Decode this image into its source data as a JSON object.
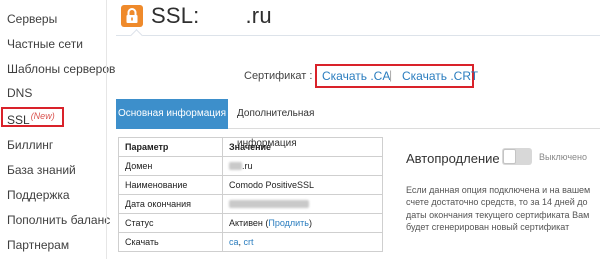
{
  "sidebar": {
    "items": [
      {
        "label": "Серверы"
      },
      {
        "label": "Частные сети"
      },
      {
        "label": "Шаблоны серверов"
      },
      {
        "label": "DNS"
      },
      {
        "label": "SSL",
        "badge": "(New)"
      },
      {
        "label": "Биллинг"
      },
      {
        "label": "База знаний"
      },
      {
        "label": "Поддержка"
      },
      {
        "label": "Пополнить баланс"
      },
      {
        "label": "Партнерам"
      }
    ]
  },
  "header": {
    "icon": "lock-icon",
    "accent_color": "#ef8a2b",
    "title_prefix": "SSL:",
    "title_domain_suffix": ".ru"
  },
  "certificate": {
    "label": "Сертификат :",
    "download_ca": "Скачать .CA",
    "separator": "|",
    "download_crt": "Скачать .CRT"
  },
  "tabs": [
    {
      "label": "Основная информация",
      "active": true
    },
    {
      "label": "Дополнительная информация",
      "active": false
    }
  ],
  "table": {
    "headers": [
      "Параметр",
      "Значение"
    ],
    "rows": [
      {
        "name": "Домен",
        "value": ".ru"
      },
      {
        "name": "Наименование",
        "value": "Comodo PositiveSSL"
      },
      {
        "name": "Дата окончания",
        "value": ""
      },
      {
        "name": "Статус",
        "value": "Активен",
        "extra_prefix": "(",
        "extra_link": "Продлить",
        "extra_suffix": ")"
      },
      {
        "name": "Скачать",
        "link_ca": "ca",
        "link_sep": ",",
        "link_crt": "crt"
      }
    ]
  },
  "autorenew": {
    "title": "Автопродление",
    "state": "Выключено",
    "enabled": false,
    "description": "Если данная опция подключена и на вашем счете достаточно средств, то за 14 дней до даты окончания текущего сертификата Вам будет сгенерирован новый сертификат"
  },
  "colors": {
    "tab_active_bg": "#3d8fcb",
    "link": "#2a7dbf",
    "highlight_box": "#d9222a"
  }
}
